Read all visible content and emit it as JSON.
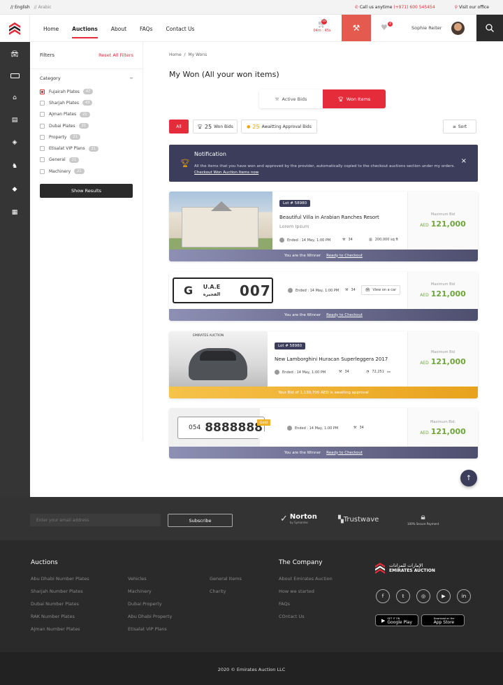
{
  "topbar": {
    "lang_en": "// English",
    "lang_ar": "// Arabic",
    "call_label": "Call us anytime",
    "phone": "(+971) 600 545454",
    "visit": "Visit our office"
  },
  "nav": {
    "items": [
      "Home",
      "Auctions",
      "About",
      "FAQs",
      "Contact Us"
    ],
    "cart_count": "10",
    "timer": "04m : 45s",
    "fav_count": "4",
    "user": "Sophie Reiter"
  },
  "filters": {
    "title": "Filters",
    "reset": "Reset All Filters",
    "category": "Category",
    "items": [
      {
        "label": "Fujairah Plates",
        "count": "47"
      },
      {
        "label": "Sharjah Plates",
        "count": "43"
      },
      {
        "label": "Ajman Plates",
        "count": "21"
      },
      {
        "label": "Dubai Plates",
        "count": "21"
      },
      {
        "label": "Property",
        "count": "21"
      },
      {
        "label": "Etisalat VIP Plans",
        "count": "21"
      },
      {
        "label": "General",
        "count": "21"
      },
      {
        "label": "Machinery",
        "count": "21"
      }
    ],
    "show": "Show Results"
  },
  "breadcrumb": {
    "home": "Home",
    "sep": "/",
    "current": "My Wons"
  },
  "page_title": "My Won (All your won items)",
  "toggle": {
    "active": "Active Bids",
    "won": "Won Items"
  },
  "chips": {
    "all": "All",
    "won_count": "25",
    "won_label": "Won Bids",
    "await_count": "25",
    "await_label": "Awaitting Approval Bids",
    "sort": "Sort"
  },
  "notification": {
    "title": "Notification",
    "text": "All the items that you have won and approved by the provider, automatically copied to the checkout auctions section under my orders.",
    "link": "Checkout Won Auction Items now",
    "close": "×"
  },
  "cards": [
    {
      "lot": "Lot # 58980",
      "title": "Beautiful Villa in Arabian Ranches Resort",
      "subtitle": "Lorem Ipsum",
      "ended": "Ended : 14 May, 1:00 PM",
      "bids": "34",
      "extra": "200,000 sq ft",
      "max_label": "Maximum Bid",
      "currency": "AED",
      "price": "121,000",
      "strip": "You are the Winner",
      "strip_link": "Ready to Checkout"
    },
    {
      "plate_letter": "G",
      "plate_country": "U.A.E",
      "plate_city": "الفجيرة",
      "plate_number": "007",
      "ended": "Ended : 14 May, 1:00 PM",
      "bids": "34",
      "view": "View on a car",
      "max_label": "Maximum Bid",
      "currency": "AED",
      "price": "121,000",
      "strip": "You are the Winner",
      "strip_link": "Ready to Checkout"
    },
    {
      "lot": "Lot # 58980",
      "brand": "EMIRATES AUCTION",
      "title": "New Lamborghini Huracan Superleggera 2017",
      "ended": "Ended : 14 May, 1:00 PM",
      "bids": "34",
      "extra": "72,251",
      "extra_unit": "km",
      "max_label": "Maximum Bid",
      "currency": "AED",
      "price": "121,000",
      "strip": "Your Bid of 1,130,700 AED is awaiting approval"
    },
    {
      "phone_prefix": "054",
      "phone_number": "8888888",
      "tag": "Gold",
      "ended": "Ended : 14 May, 1:00 PM",
      "bids": "34",
      "max_label": "Maximum Bid:",
      "currency": "AED",
      "price": "121,000",
      "strip": "You are the Winner",
      "strip_link": "Ready to Checkout"
    }
  ],
  "footer": {
    "email_placeholder": "Enter your email address",
    "subscribe": "Subscribe",
    "norton": "Norton",
    "norton_sub": "by Symantec",
    "trustwave": "Trustwave",
    "secure": "100% Secure Payment",
    "auctions_title": "Auctions",
    "col1": [
      "Abu Dhabi Number Plates",
      "Sharjah Number Plates",
      "Dubai Number Plates",
      "RAK Number Plates",
      "Ajman Number Plates"
    ],
    "col2": [
      "Vehicles",
      "Machinery",
      "Dubai Property",
      "Abu Dhabi Property",
      "Etisalat VIP Plans"
    ],
    "col3": [
      "General Items",
      "Charity"
    ],
    "company_title": "The Company",
    "col4": [
      "About Emirates Auction",
      "How we started",
      "FAQs",
      "COntact Us"
    ],
    "brand_ar": "الإمارات للمزادات",
    "brand": "EMIRATES AUCTION",
    "gp_small": "GET IT ON",
    "gp": "Google Play",
    "as_small": "Download on the",
    "as": "App Store",
    "copyright": "2020 © Emirates Auction LLC"
  }
}
